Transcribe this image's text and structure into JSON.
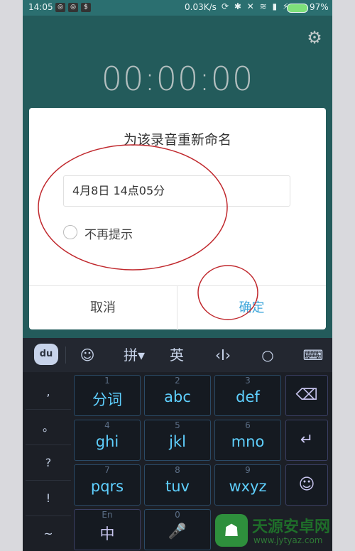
{
  "status_bar": {
    "time": "14:05",
    "network_speed": "0.03K/s",
    "battery_percent": "97%"
  },
  "recorder": {
    "timer": "00:00:00"
  },
  "rename_dialog": {
    "title": "为该录音重新命名",
    "name_value": "4月8日 14点05分",
    "dont_remind_label": "不再提示",
    "cancel_label": "取消",
    "confirm_label": "确定"
  },
  "keyboard": {
    "toolbar": {
      "logo": "du",
      "emoji": "☺",
      "pinyin": "拼▾",
      "english": "英",
      "cursor": "‹I›",
      "search": "○",
      "keyboard": "⌨"
    },
    "left_punct": [
      ",",
      "。",
      "?",
      "!",
      "~"
    ],
    "keys": [
      {
        "num": "1",
        "label": "分词"
      },
      {
        "num": "2",
        "label": "abc"
      },
      {
        "num": "3",
        "label": "def"
      },
      {
        "num": "4",
        "label": "ghi"
      },
      {
        "num": "5",
        "label": "jkl"
      },
      {
        "num": "6",
        "label": "mno"
      },
      {
        "num": "7",
        "label": "pqrs"
      },
      {
        "num": "8",
        "label": "tuv"
      },
      {
        "num": "9",
        "label": "wxyz"
      },
      {
        "num": "En",
        "label": "中"
      },
      {
        "num": "0",
        "label": "🎤"
      }
    ],
    "right_keys": {
      "delete": "⌫",
      "enter": "↵",
      "emoji": "☺"
    }
  },
  "watermark": {
    "name": "天源安卓网",
    "url": "www.jytyaz.com"
  },
  "colors": {
    "app_bg": "#2b6f70",
    "confirm_text": "#3ba4d9",
    "annotation": "#c0282d"
  }
}
